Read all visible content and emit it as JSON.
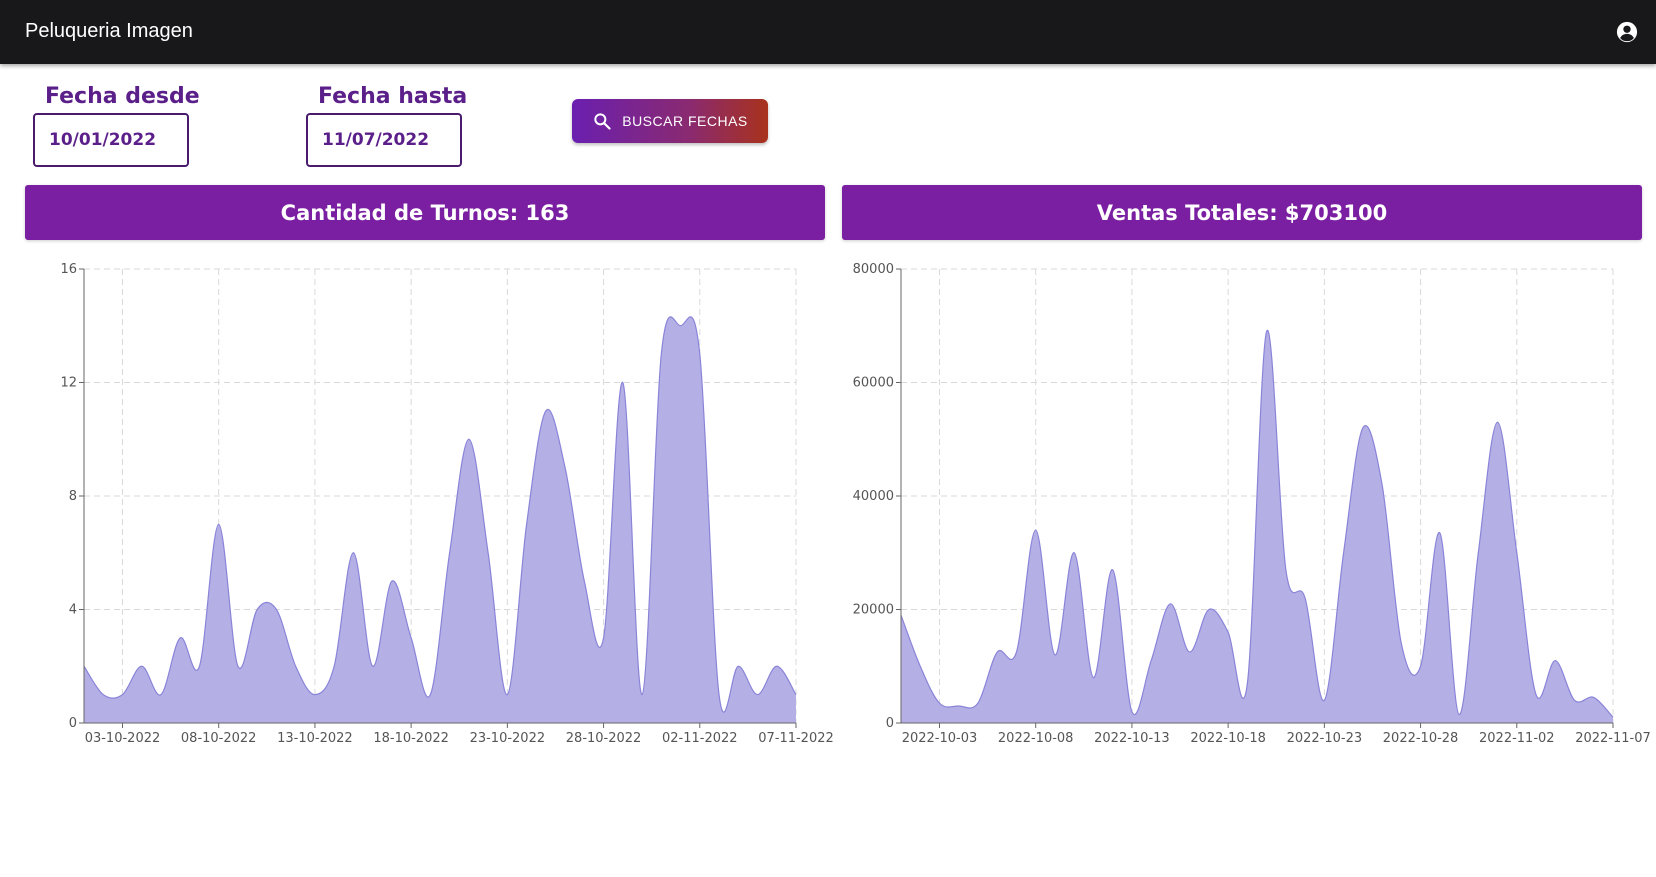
{
  "appbar": {
    "title": "Peluqueria Imagen",
    "account_icon": "account-circle-icon"
  },
  "filters": {
    "from_label": "Fecha desde",
    "from_value": "10/01/2022",
    "to_label": "Fecha hasta",
    "to_value": "11/07/2022",
    "search_button": "BUSCAR FECHAS",
    "search_icon": "search-icon"
  },
  "colors": {
    "banner": "#7b1fa2",
    "area_fill": "#b4b0e6",
    "area_stroke": "#8a84d8",
    "label": "#5b1f8a"
  },
  "banners": {
    "turnos": "Cantidad de Turnos: 163",
    "ventas": "Ventas Totales: $703100"
  },
  "chart_data": [
    {
      "type": "area",
      "title": "",
      "xlabel": "",
      "ylabel": "",
      "ylim": [
        0,
        16
      ],
      "yticks": [
        "0",
        "4",
        "8",
        "12",
        "16"
      ],
      "xticks": [
        "03-10-2022",
        "08-10-2022",
        "13-10-2022",
        "18-10-2022",
        "23-10-2022",
        "28-10-2022",
        "02-11-2022",
        "07-11-2022"
      ],
      "grid": true,
      "x": [
        "01-10-2022",
        "02-10-2022",
        "03-10-2022",
        "04-10-2022",
        "05-10-2022",
        "06-10-2022",
        "07-10-2022",
        "08-10-2022",
        "09-10-2022",
        "10-10-2022",
        "11-10-2022",
        "12-10-2022",
        "13-10-2022",
        "14-10-2022",
        "15-10-2022",
        "16-10-2022",
        "17-10-2022",
        "18-10-2022",
        "19-10-2022",
        "20-10-2022",
        "21-10-2022",
        "22-10-2022",
        "23-10-2022",
        "24-10-2022",
        "25-10-2022",
        "26-10-2022",
        "27-10-2022",
        "28-10-2022",
        "29-10-2022",
        "30-10-2022",
        "31-10-2022",
        "01-11-2022",
        "02-11-2022",
        "03-11-2022",
        "04-11-2022",
        "05-11-2022",
        "06-11-2022",
        "07-11-2022"
      ],
      "values": [
        2,
        1,
        1,
        2,
        1,
        3,
        2,
        7,
        2,
        4,
        4,
        2,
        1,
        2,
        6,
        2,
        5,
        3,
        1,
        6,
        10,
        6,
        1,
        7,
        11,
        9,
        5,
        3,
        12,
        1,
        13,
        14,
        13,
        1,
        2,
        1,
        2,
        1
      ]
    },
    {
      "type": "area",
      "title": "",
      "xlabel": "",
      "ylabel": "",
      "ylim": [
        0,
        80000
      ],
      "yticks": [
        "0",
        "20000",
        "40000",
        "60000",
        "80000"
      ],
      "xticks": [
        "2022-10-03",
        "2022-10-08",
        "2022-10-13",
        "2022-10-18",
        "2022-10-23",
        "2022-10-28",
        "2022-11-02",
        "2022-11-07"
      ],
      "grid": true,
      "x": [
        "2022-10-01",
        "2022-10-02",
        "2022-10-03",
        "2022-10-04",
        "2022-10-05",
        "2022-10-06",
        "2022-10-07",
        "2022-10-08",
        "2022-10-09",
        "2022-10-10",
        "2022-10-11",
        "2022-10-12",
        "2022-10-13",
        "2022-10-14",
        "2022-10-15",
        "2022-10-16",
        "2022-10-17",
        "2022-10-18",
        "2022-10-19",
        "2022-10-20",
        "2022-10-21",
        "2022-10-22",
        "2022-10-23",
        "2022-10-24",
        "2022-10-25",
        "2022-10-26",
        "2022-10-27",
        "2022-10-28",
        "2022-10-29",
        "2022-10-30",
        "2022-10-31",
        "2022-11-01",
        "2022-11-02",
        "2022-11-03",
        "2022-11-04",
        "2022-11-05",
        "2022-11-06",
        "2022-11-07"
      ],
      "values": [
        19000,
        10000,
        3500,
        3000,
        3500,
        12500,
        12500,
        34000,
        12000,
        30000,
        8000,
        27000,
        2000,
        11000,
        21000,
        12500,
        20000,
        16000,
        7000,
        69000,
        27000,
        22000,
        4000,
        30000,
        52000,
        42000,
        14000,
        10000,
        33500,
        1500,
        30000,
        53000,
        30000,
        5000,
        11000,
        4000,
        4500,
        1000
      ]
    }
  ]
}
